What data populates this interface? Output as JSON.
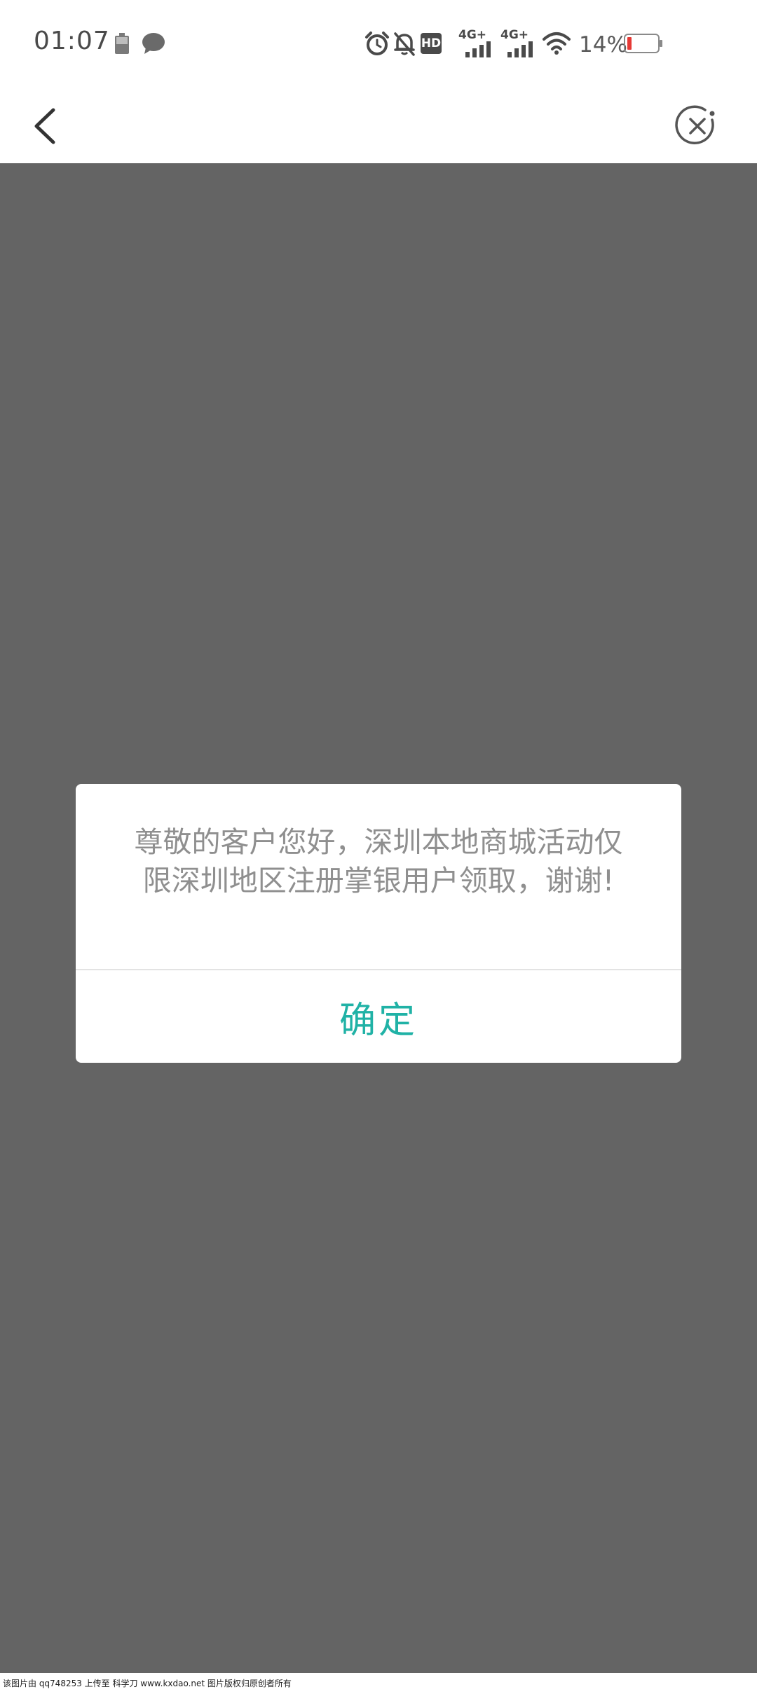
{
  "status_bar": {
    "time": "01:07",
    "battery_percent": "14%",
    "network_1": "4G+",
    "network_2": "4G+",
    "hd_label": "HD",
    "icons": [
      "battery-small-icon",
      "chat-bubble-icon",
      "alarm-icon",
      "mute-bell-icon",
      "hd-icon",
      "signal-icon",
      "signal-icon",
      "wifi-icon",
      "battery-icon"
    ]
  },
  "nav": {
    "back_icon": "chevron-left-icon",
    "close_icon": "close-circle-icon"
  },
  "dialog": {
    "message": "尊敬的客户您好，深圳本地商城活动仅限深圳地区注册掌银用户领取，谢谢!",
    "confirm_label": "确定",
    "accent_color": "#20b2a6"
  },
  "watermark": {
    "text": "该图片由 qq748253 上传至 科学刀 www.kxdao.net 图片版权归原创者所有"
  }
}
